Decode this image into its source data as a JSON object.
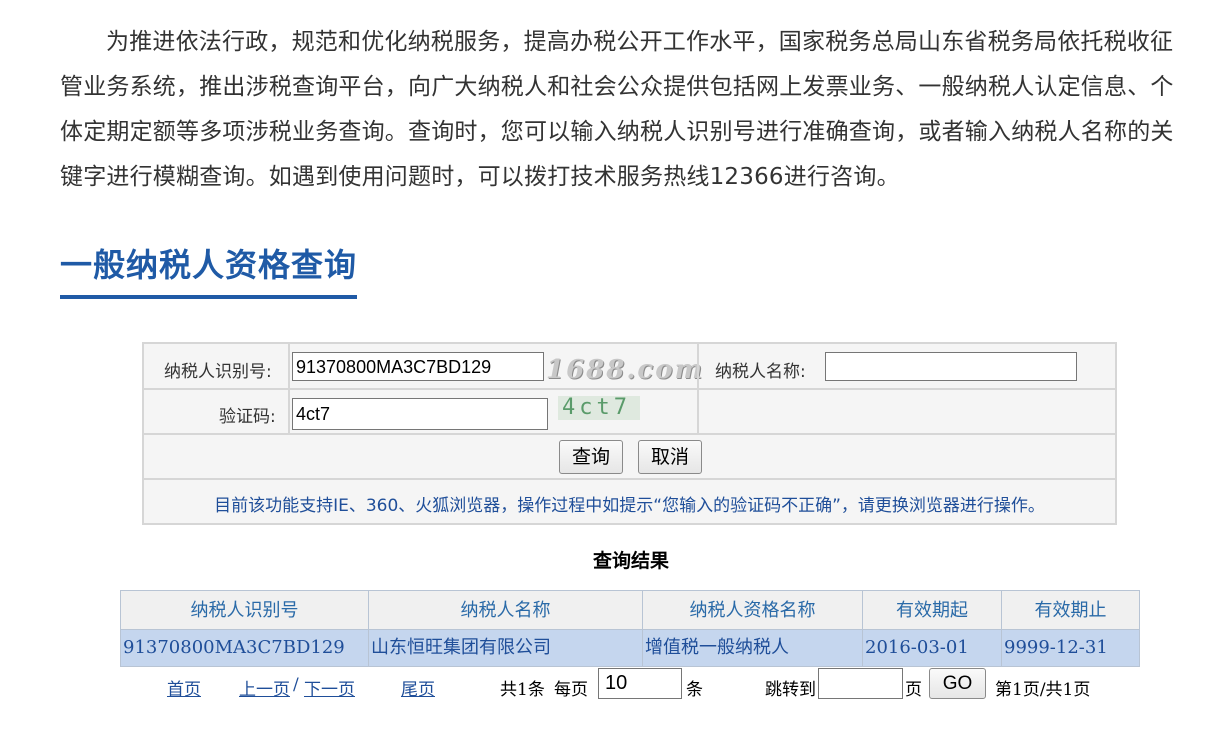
{
  "intro": {
    "text": "为推进依法行政，规范和优化纳税服务，提高办税公开工作水平，国家税务总局山东省税务局依托税收征管业务系统，推出涉税查询平台，向广大纳税人和社会公众提供包括网上发票业务、一般纳税人认定信息、个体定期定额等多项涉税业务查询。查询时，您可以输入纳税人识别号进行准确查询，或者输入纳税人名称的关键字进行模糊查询。如遇到使用问题时，可以拨打技术服务热线12366进行咨询。"
  },
  "section": {
    "title": "一般纳税人资格查询"
  },
  "form": {
    "taxpayer_id_label": "纳税人识别号:",
    "taxpayer_id_value": "91370800MA3C7BD129",
    "watermark": "1688.com",
    "taxpayer_name_label": "纳税人名称:",
    "taxpayer_name_value": "",
    "captcha_label": "验证码:",
    "captcha_value": "4ct7",
    "captcha_image_text": "4ct7",
    "query_button": "查询",
    "cancel_button": "取消",
    "notice": "目前该功能支持IE、360、火狐浏览器，操作过程中如提示“您输入的验证码不正确”，请更换浏览器进行操作。"
  },
  "results": {
    "title": "查询结果",
    "columns": [
      "纳税人识别号",
      "纳税人名称",
      "纳税人资格名称",
      "有效期起",
      "有效期止"
    ],
    "rows": [
      [
        "91370800MA3C7BD129",
        "山东恒旺集团有限公司",
        "增值税一般纳税人",
        "2016-03-01",
        "9999-12-31"
      ]
    ],
    "row_highlight_color": "#c5d6ee"
  },
  "pager": {
    "first": "首页",
    "prev": "上一页",
    "sep": "/",
    "next": "下一页",
    "last": "尾页",
    "total": "共1条",
    "per_page_label": "每页",
    "per_page_value": "10",
    "per_page_unit": "条",
    "jump_label": "跳转到",
    "jump_value": "",
    "page_unit": "页",
    "go_button": "GO",
    "status": "第1页/共1页"
  },
  "colors": {
    "accent": "#1f5aa6",
    "link": "#1f4e99"
  }
}
